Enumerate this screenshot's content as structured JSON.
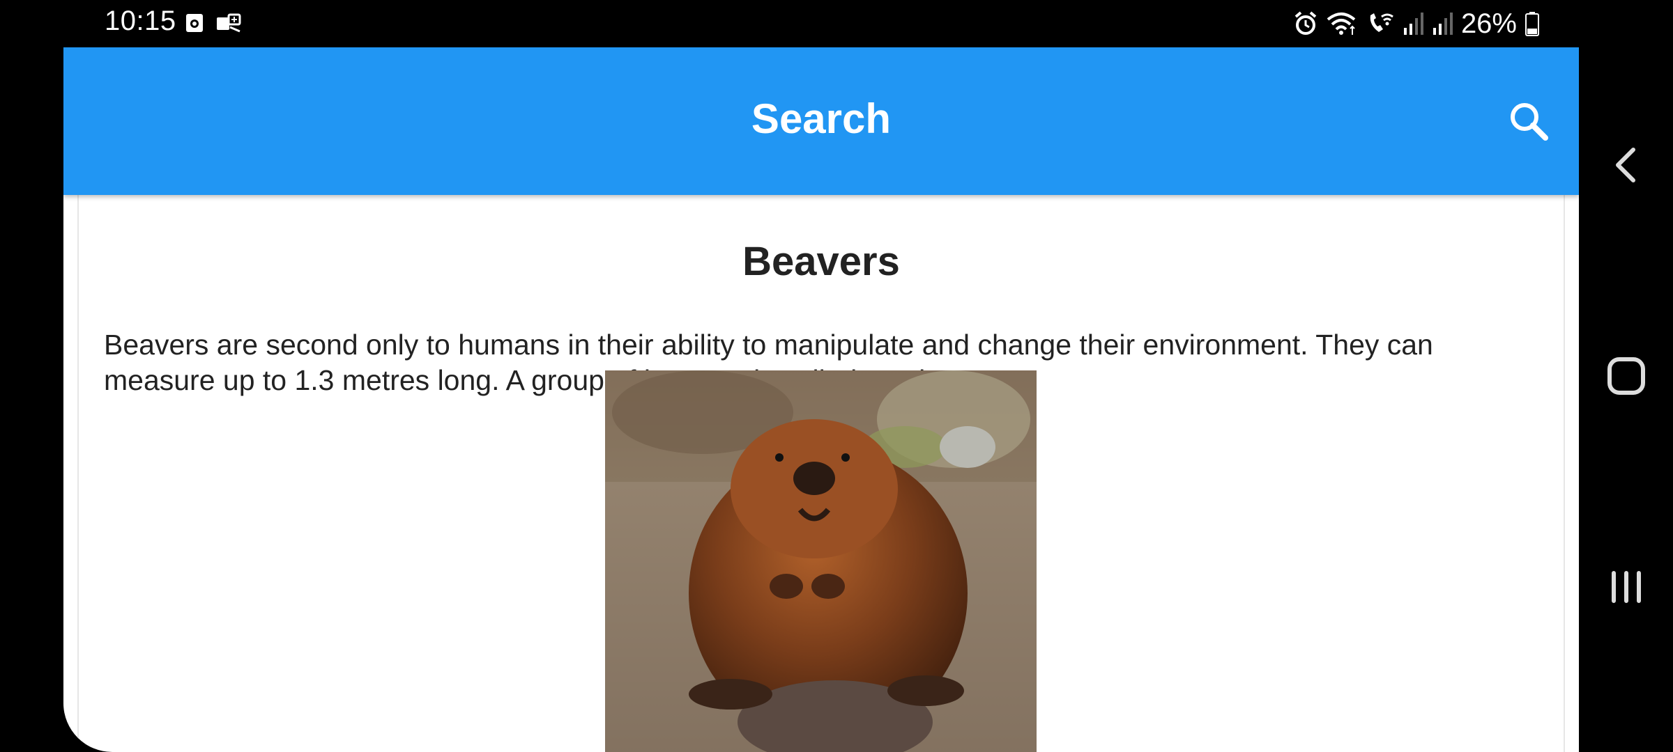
{
  "status_bar": {
    "time": "10:15",
    "battery": "26%",
    "notification_icons": [
      "calendar-icon",
      "video-call-icon"
    ],
    "system_icons": [
      "alarm-icon",
      "wifi-icon",
      "wifi-calling-icon",
      "signal-icon",
      "signal-icon",
      "battery-icon"
    ]
  },
  "app_bar": {
    "title": "Search",
    "search_icon": "search-icon",
    "color": "#2196f3"
  },
  "card": {
    "title": "Beavers",
    "text": "Beavers are second only to humans in their ability to manipulate and change their environment. They can measure up to 1.3 metres long. A group of beavers is called a colony",
    "image": "beaver-photo"
  },
  "nav_bar": {
    "buttons": [
      "back-icon",
      "home-icon",
      "recents-icon"
    ]
  }
}
